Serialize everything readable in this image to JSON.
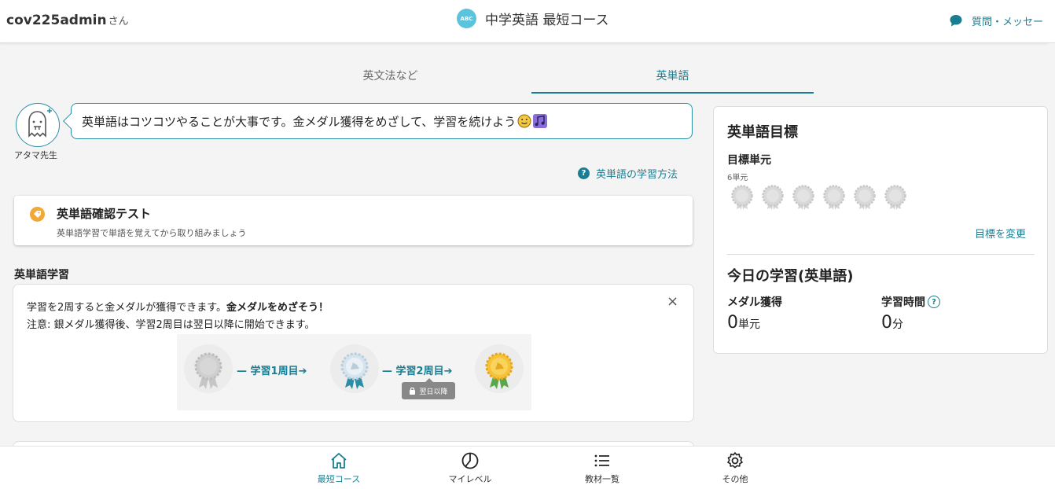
{
  "header": {
    "username": "cov225admin",
    "honorific": "さん",
    "course_badge": "ABC",
    "course_title": "中学英語 最短コース",
    "message_link": "質問・メッセー"
  },
  "tabs": [
    {
      "label": "英文法など",
      "active": false
    },
    {
      "label": "英単語",
      "active": true
    }
  ],
  "sensei": {
    "name": "アタマ先生",
    "message": "英単語はコツコツやることが大事です。金メダル獲得をめざして、学習を続けよう"
  },
  "howto_link": "英単語の学習方法",
  "test_card": {
    "title": "英単語確認テスト",
    "subtitle": "英単語学習で単語を覚えてから取り組みましょう"
  },
  "study_section": {
    "title": "英単語学習",
    "info_line1_prefix": "学習を2周すると金メダルが獲得できます。",
    "info_line1_bold": "金メダルをめざそう！",
    "info_line2": "注意: 銀メダル獲得後、学習2周目は翌日以降に開始できます。",
    "flow_step1": "— 学習1周目➔",
    "flow_step2": "— 学習2周目➔",
    "lock_label": "翌日以降",
    "close": "×"
  },
  "goal_panel": {
    "title": "英単語目標",
    "target_label": "目標単元",
    "target_count": "6単元",
    "medal_count": 6,
    "change_link": "目標を変更",
    "today_title": "今日の学習(英単語)",
    "medal_label": "メダル獲得",
    "medal_value": "0",
    "medal_unit": "単元",
    "time_label": "学習時間",
    "time_value": "0",
    "time_unit": "分"
  },
  "bottom_nav": [
    {
      "label": "最短コース",
      "icon": "home-icon",
      "active": true
    },
    {
      "label": "マイレベル",
      "icon": "pie-chart-icon",
      "active": false
    },
    {
      "label": "教材一覧",
      "icon": "list-icon",
      "active": false
    },
    {
      "label": "その他",
      "icon": "gear-icon",
      "active": false
    }
  ],
  "colors": {
    "accent": "#1a7e93",
    "badge": "#5bc4dc",
    "tag": "#f2a839"
  }
}
